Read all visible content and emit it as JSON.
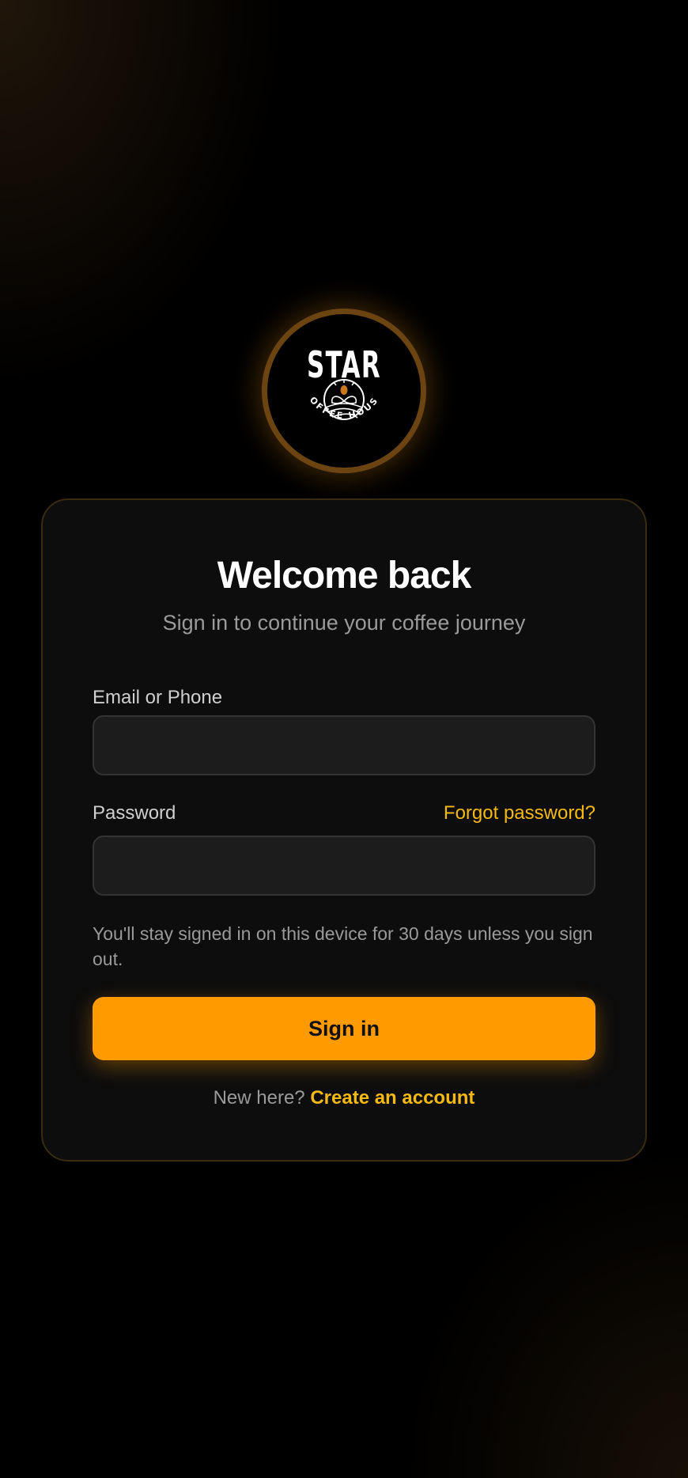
{
  "logo": {
    "name": "STAR",
    "tagline": "COFFEE HOUSE"
  },
  "header": {
    "title": "Welcome back",
    "subtitle": "Sign in to continue your coffee journey"
  },
  "form": {
    "email_label": "Email or Phone",
    "email_value": "",
    "password_label": "Password",
    "password_value": "",
    "forgot_link": "Forgot password?",
    "session_note": "You'll stay signed in on this device for 30 days unless you sign out.",
    "submit_label": "Sign in"
  },
  "footer": {
    "prompt": "New here?",
    "create_link": "Create an account"
  },
  "colors": {
    "accent": "#ff9a00",
    "link": "#f5b914",
    "background": "#000000",
    "card": "#0d0d0d"
  }
}
